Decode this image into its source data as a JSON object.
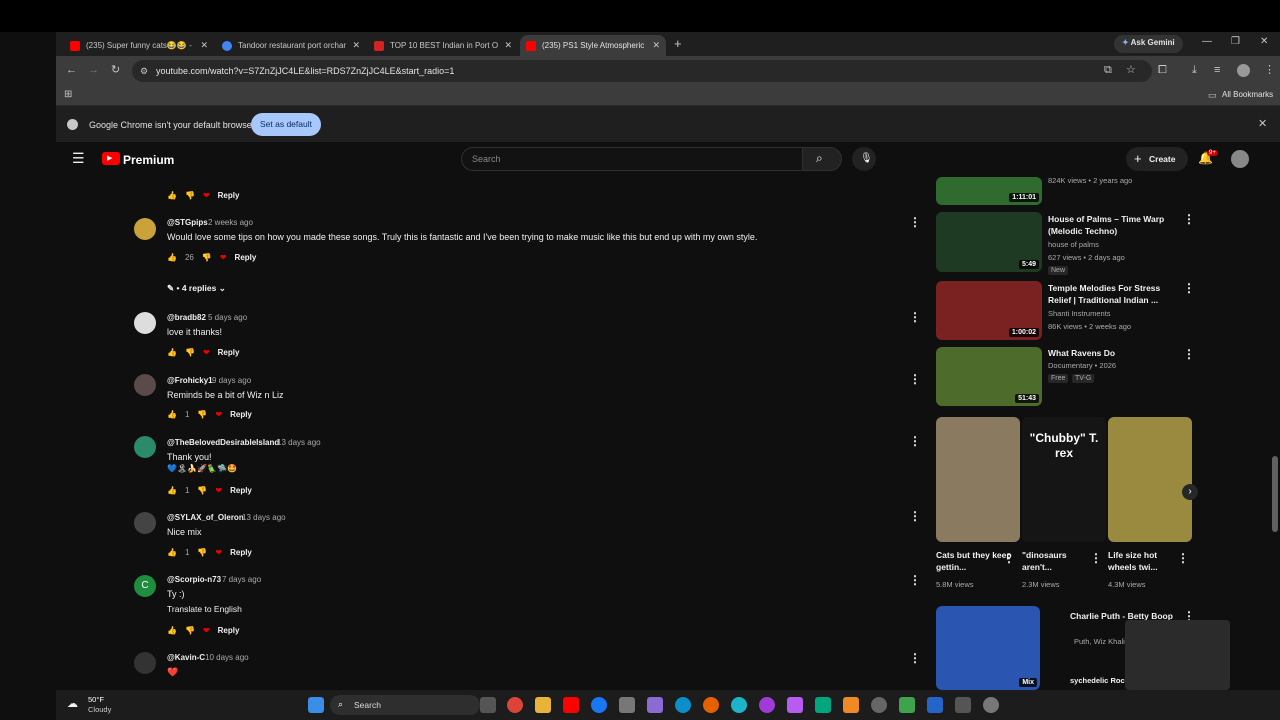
{
  "tabs": [
    {
      "label": "(235) Super funny cats😂😂 - Y",
      "color": "#ff0000"
    },
    {
      "label": "Tandoor restaurant port orchard",
      "color": "#4285f4"
    },
    {
      "label": "TOP 10 BEST Indian in Port Orch",
      "color": "#d32323"
    },
    {
      "label": "(235) PS1 Style Atmospheric D",
      "color": "#ff0000"
    }
  ],
  "ask_gemini": "Ask Gemini",
  "url": "youtube.com/watch?v=S7ZnZjJC4LE&list=RDS7ZnZjJC4LE&start_radio=1",
  "all_bookmarks": "All Bookmarks",
  "infobar": {
    "message": "Google Chrome isn't your default browser",
    "button": "Set as default"
  },
  "yt": {
    "logo": "Premium",
    "search_placeholder": "Search",
    "create": "Create",
    "notif_count": "9+"
  },
  "comments": [
    {
      "handle": "@STGpips",
      "ago": "2 weeks ago",
      "text": "Would love some tips on how you made these songs. Truly this is fantastic and I've been trying to make music like this but end up with my own style.",
      "likes": "26",
      "replies": "4 replies"
    },
    {
      "handle": "@bradb82",
      "ago": "5 days ago",
      "text": "love it thanks!",
      "likes": ""
    },
    {
      "handle": "@Frohicky1",
      "ago": "9 days ago",
      "text": "Reminds be a bit of Wiz n Liz",
      "likes": "1"
    },
    {
      "handle": "@TheBelovedDesirableIsland",
      "ago": "13 days ago",
      "text": "Thank you!",
      "emoji": "💙🏝🍌🚀🦜🛸🤩",
      "likes": "1"
    },
    {
      "handle": "@SYLAX_of_Oleron",
      "ago": "13 days ago",
      "text": "Nice mix",
      "likes": "1"
    },
    {
      "handle": "@Scorpio-n73",
      "ago": "7 days ago",
      "text": "Ty :)",
      "translate": "Translate to English",
      "likes": ""
    },
    {
      "handle": "@Kavin-C",
      "ago": "10 days ago",
      "text": "❤️",
      "likes": ""
    }
  ],
  "reply_label": "Reply",
  "videos": [
    {
      "title": "",
      "channel": "",
      "meta": "824K views • 2 years ago",
      "duration": "1:11:01"
    },
    {
      "title": "House of Palms – Time Warp (Melodic Techno)",
      "channel": "house of palms",
      "meta": "627 views • 2 days ago",
      "badge": "New",
      "duration": "5:49"
    },
    {
      "title": "Temple Melodies For Stress Relief | Traditional Indian ...",
      "channel": "Shanti Instruments",
      "meta": "86K views • 2 weeks ago",
      "duration": "1:00:02"
    },
    {
      "title": "What Ravens Do",
      "channel": "Documentary • 2026",
      "badge1": "Free",
      "badge2": "TV-G",
      "duration": "51:43"
    }
  ],
  "shorts": [
    {
      "title": "Cats but they keep gettin...",
      "views": "5.8M views"
    },
    {
      "title": "\"dinosaurs aren't...",
      "views": "2.3M views",
      "thumb_text": "\"Chubby\" T. rex"
    },
    {
      "title": "Life size hot wheels twi...",
      "views": "4.3M views"
    }
  ],
  "mix": {
    "title": "Charlie Puth - Betty Boop",
    "sub": "Puth, Wiz Khalifa",
    "sub2": "sychedelic Rock",
    "label": "Mix"
  },
  "weather": {
    "temp": "50°F",
    "cond": "Cloudy"
  },
  "taskbar_search": "Search"
}
